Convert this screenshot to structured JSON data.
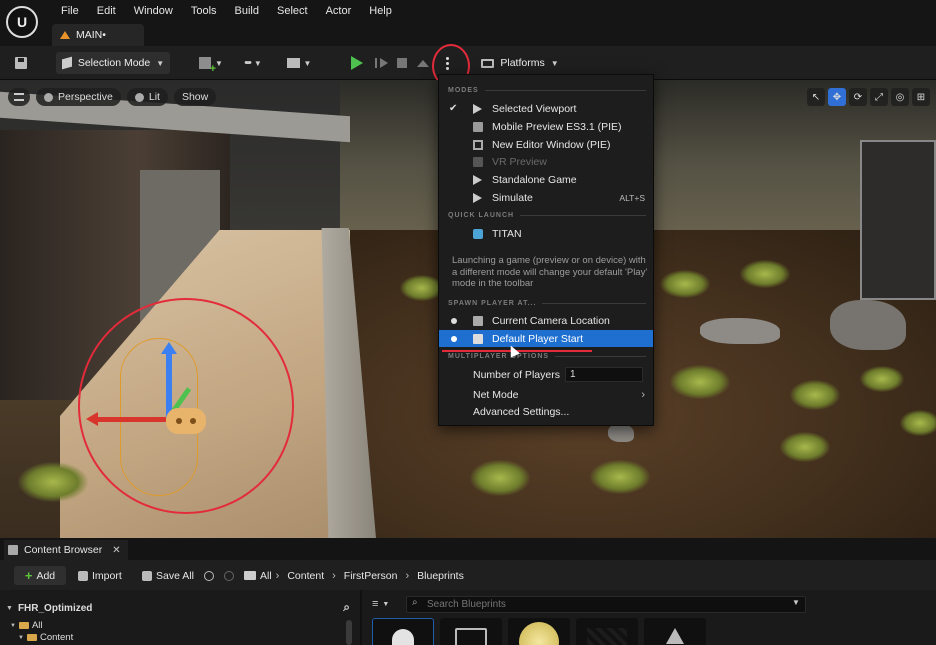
{
  "app": {
    "menu": [
      "File",
      "Edit",
      "Window",
      "Tools",
      "Build",
      "Select",
      "Actor",
      "Help"
    ],
    "level_tab": "MAIN•"
  },
  "toolbar": {
    "selection_mode": "Selection Mode",
    "platforms": "Platforms"
  },
  "viewport": {
    "perspective": "Perspective",
    "lit": "Lit",
    "show": "Show"
  },
  "play_menu": {
    "modes_header": "MODES",
    "modes": [
      {
        "label": "Selected Viewport",
        "checked": true,
        "enabled": true
      },
      {
        "label": "Mobile Preview ES3.1 (PIE)",
        "enabled": true
      },
      {
        "label": "New Editor Window (PIE)",
        "enabled": true
      },
      {
        "label": "VR Preview",
        "enabled": false
      },
      {
        "label": "Standalone Game",
        "enabled": true
      },
      {
        "label": "Simulate",
        "shortcut": "ALT+S",
        "enabled": true
      }
    ],
    "quick_launch_header": "QUICK LAUNCH",
    "quick_launch_item": "TITAN",
    "note": "Launching a game (preview or on device) with a different mode will change your default 'Play' mode in the toolbar",
    "spawn_header": "SPAWN PLAYER AT...",
    "spawn_items": [
      {
        "label": "Current Camera Location",
        "selected": false
      },
      {
        "label": "Default Player Start",
        "selected": true
      }
    ],
    "multiplayer_header": "MULTIPLAYER OPTIONS",
    "num_players_label": "Number of Players",
    "num_players_value": "1",
    "net_mode_label": "Net Mode",
    "advanced_settings_label": "Advanced Settings..."
  },
  "content_browser": {
    "tab_label": "Content Browser",
    "add_label": "Add",
    "import_label": "Import",
    "save_all_label": "Save All",
    "breadcrumb": [
      "All",
      "Content",
      "FirstPerson",
      "Blueprints"
    ],
    "left_header": "FHR_Optimized",
    "tree": [
      "All",
      "Content"
    ],
    "search_placeholder": "Search Blueprints"
  },
  "colors": {
    "accent": "#1f6fd1",
    "annotation_red": "#e32b3a",
    "play_green": "#4ec14e"
  }
}
